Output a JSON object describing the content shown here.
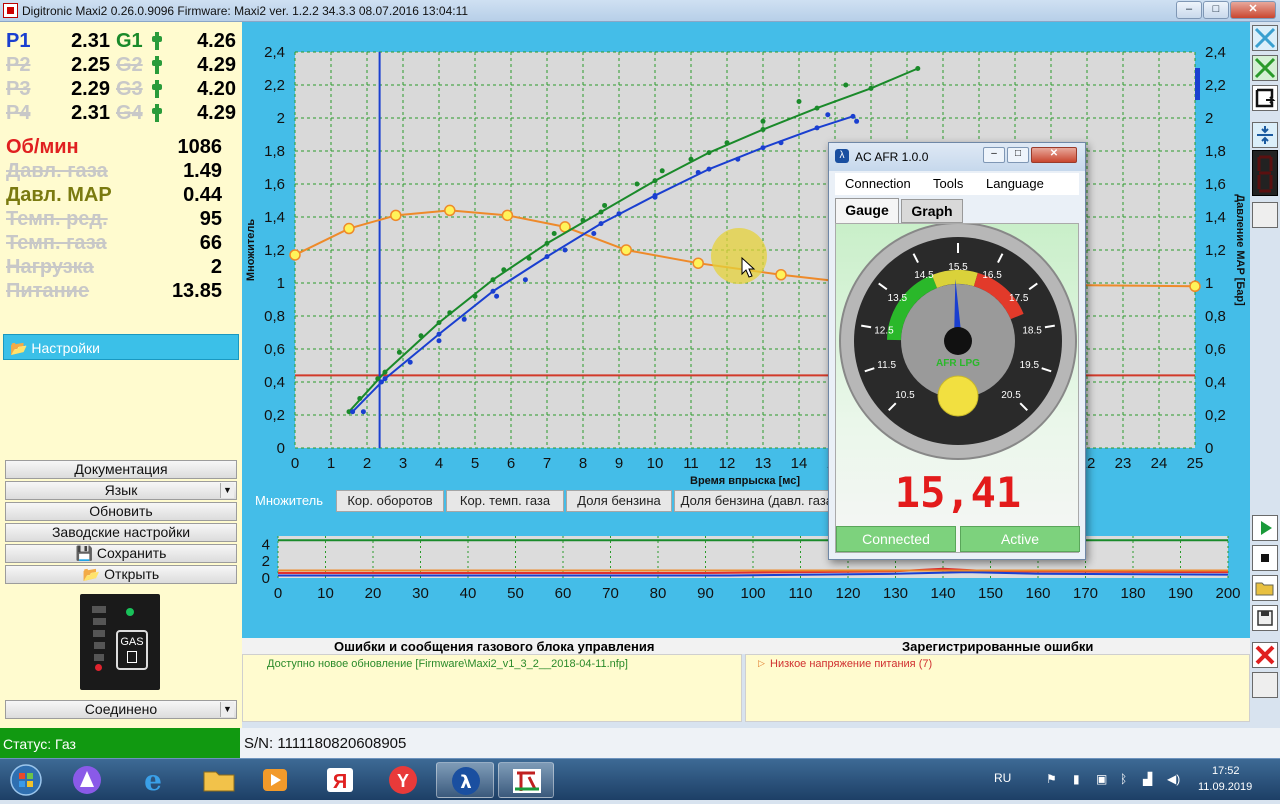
{
  "window": {
    "title": "Digitronic Maxi2 0.26.0.9096 Firmware: Maxi2 ver. 1.2.2  34.3.3   08.07.2016 13:04:11",
    "minimize": "‒",
    "maximize": "□",
    "close": "✕"
  },
  "pressures": [
    {
      "label": "P1",
      "value": "2.31",
      "glabel": "G1",
      "gvalue": "4.26",
      "active": true
    },
    {
      "label": "P2",
      "value": "2.25",
      "glabel": "G2",
      "gvalue": "4.29",
      "active": false
    },
    {
      "label": "P3",
      "value": "2.29",
      "glabel": "G3",
      "gvalue": "4.20",
      "active": false
    },
    {
      "label": "P4",
      "value": "2.31",
      "glabel": "G4",
      "gvalue": "4.29",
      "active": false
    }
  ],
  "sensors": [
    {
      "label": "Об/мин",
      "value": "1086",
      "style": "red"
    },
    {
      "label": "Давл. газа",
      "value": "1.49",
      "style": "strike"
    },
    {
      "label": "Давл. MAP",
      "value": "0.44",
      "style": "olive"
    },
    {
      "label": "Темп. ред.",
      "value": "95",
      "style": "strike"
    },
    {
      "label": "Темп. газа",
      "value": "66",
      "style": "strike"
    },
    {
      "label": "Нагрузка",
      "value": "2",
      "style": "strike"
    },
    {
      "label": "Питание",
      "value": "13.85",
      "style": "strike"
    }
  ],
  "settings_label": "Настройки",
  "left_buttons": {
    "docs": "Документация",
    "lang": "Язык",
    "update": "Обновить",
    "factory": "Заводские настройки",
    "save": "Сохранить",
    "open": "Открыть",
    "connected": "Соединено"
  },
  "gas_switch": {
    "label": "GAS"
  },
  "chart": {
    "xlabel": "Время впрыска [мс]",
    "ylabel_left": "Множитель",
    "ylabel_right": "Давление MAP [Бар]"
  },
  "chart_data": [
    {
      "type": "scatter",
      "title": "",
      "xlabel": "Время впрыска [мс]",
      "ylabel": "Множитель",
      "y2label": "Давление MAP [Бар]",
      "xlim": [
        0,
        25
      ],
      "ylim": [
        0,
        2.4
      ],
      "y2lim": [
        0,
        2.4
      ],
      "x_ticks": [
        "0",
        "1",
        "2",
        "3",
        "4",
        "5",
        "6",
        "7",
        "8",
        "9",
        "10",
        "11",
        "12",
        "13",
        "14",
        "15",
        "16",
        "17",
        "18",
        "19",
        "20",
        "21",
        "22",
        "23",
        "24",
        "25"
      ],
      "y_ticks": [
        "0",
        "0,2",
        "0,4",
        "0,6",
        "0,8",
        "1",
        "1,2",
        "1,4",
        "1,6",
        "1,8",
        "2",
        "2,2",
        "2,4"
      ],
      "marker_line_x": 2.35,
      "reference_line_y": 0.44,
      "series": [
        {
          "color": "#ee8a2a",
          "kind": "line",
          "x": [
            0,
            1.5,
            2.8,
            4.3,
            5.9,
            7.5,
            9.2,
            11.2,
            13.5,
            15.5,
            25
          ],
          "y": [
            1.17,
            1.33,
            1.41,
            1.44,
            1.41,
            1.34,
            1.2,
            1.12,
            1.05,
            1.0,
            0.98
          ]
        },
        {
          "color": "#1a8a2a",
          "kind": "line",
          "x": [
            1.5,
            2.5,
            4,
            5.5,
            7,
            8.5,
            10,
            11.5,
            13,
            14.5,
            16,
            17.3
          ],
          "y": [
            0.22,
            0.46,
            0.76,
            1.02,
            1.24,
            1.43,
            1.62,
            1.79,
            1.93,
            2.06,
            2.18,
            2.3
          ]
        },
        {
          "color": "#1a3fd0",
          "kind": "line",
          "x": [
            1.6,
            2.5,
            4,
            5.5,
            7,
            8.5,
            10,
            11.5,
            13,
            14.5,
            15.5
          ],
          "y": [
            0.22,
            0.42,
            0.69,
            0.95,
            1.16,
            1.36,
            1.53,
            1.69,
            1.82,
            1.94,
            2.01
          ]
        },
        {
          "color": "#1a8a2a",
          "kind": "points",
          "x": [
            1.8,
            2.3,
            2.9,
            3.5,
            4.3,
            5.0,
            5.8,
            6.5,
            7.2,
            8.0,
            8.6,
            9.5,
            10.2,
            11.0,
            12.0,
            13.0,
            14.0,
            15.3
          ],
          "y": [
            0.3,
            0.42,
            0.58,
            0.68,
            0.82,
            0.92,
            1.08,
            1.15,
            1.3,
            1.38,
            1.47,
            1.6,
            1.68,
            1.75,
            1.85,
            1.98,
            2.1,
            2.2
          ]
        },
        {
          "color": "#1a3fd0",
          "kind": "points",
          "x": [
            1.9,
            2.4,
            3.2,
            4.0,
            4.7,
            5.6,
            6.4,
            7.5,
            8.3,
            9.0,
            10.0,
            11.2,
            12.3,
            13.5,
            14.8,
            15.6
          ],
          "y": [
            0.22,
            0.4,
            0.52,
            0.65,
            0.78,
            0.92,
            1.02,
            1.2,
            1.3,
            1.42,
            1.52,
            1.67,
            1.75,
            1.85,
            2.02,
            1.98
          ]
        }
      ]
    },
    {
      "type": "line",
      "title": "",
      "xlim": [
        0,
        200
      ],
      "ylim": [
        0,
        5
      ],
      "x_ticks": [
        "0",
        "10",
        "20",
        "30",
        "40",
        "50",
        "60",
        "70",
        "80",
        "90",
        "100",
        "110",
        "120",
        "130",
        "140",
        "150",
        "160",
        "170",
        "180",
        "190",
        "200"
      ],
      "y_ticks": [
        "0",
        "2",
        "4"
      ],
      "series": [
        {
          "color": "#1a8a2a",
          "x": [
            0,
            200
          ],
          "y": [
            4.5,
            4.5
          ]
        },
        {
          "color": "#e03030",
          "x": [
            0,
            90,
            130,
            140,
            150,
            200
          ],
          "y": [
            0.6,
            0.6,
            0.8,
            1.1,
            0.8,
            0.7
          ]
        },
        {
          "color": "#1a3fd0",
          "x": [
            0,
            95,
            130,
            145,
            160,
            200
          ],
          "y": [
            0.3,
            0.3,
            0.5,
            0.7,
            0.5,
            0.4
          ]
        },
        {
          "color": "#ee8a2a",
          "x": [
            0,
            200
          ],
          "y": [
            0.9,
            0.9
          ]
        }
      ]
    }
  ],
  "tabs": [
    "Множитель",
    "Кор. оборотов",
    "Кор. темп. газа",
    "Доля бензина",
    "Доля бензина (давл. газа)"
  ],
  "errors": {
    "title": "Ошибки и сообщения газового блока управления",
    "message": "Доступно новое обновление [Firmware\\Maxi2_v1_3_2__2018-04-11.nfp]"
  },
  "registered": {
    "title": "Зарегистрированные ошибки",
    "message": "Низкое напряжение питания (7)"
  },
  "status": "Статус: Газ",
  "serial": "S/N: 1111180820608905",
  "popup": {
    "title": "AC AFR   1.0.0",
    "menu": [
      "Connection",
      "Tools",
      "Language"
    ],
    "tabs": [
      "Gauge",
      "Graph"
    ],
    "afr_value": "15,41",
    "needle_value": 15.41,
    "gauge_min": 10.5,
    "gauge_max": 20.5,
    "gauge_label": "AFR LPG",
    "gauge_ticks": [
      "10.5",
      "11.5",
      "12.5",
      "13.5",
      "14.5",
      "15.5",
      "16.5",
      "17.5",
      "18.5",
      "19.5",
      "20.5"
    ],
    "connected": "Connected",
    "active": "Active"
  },
  "taskbar": {
    "lang": "RU",
    "time": "17:52",
    "date": "11.09.2019"
  }
}
